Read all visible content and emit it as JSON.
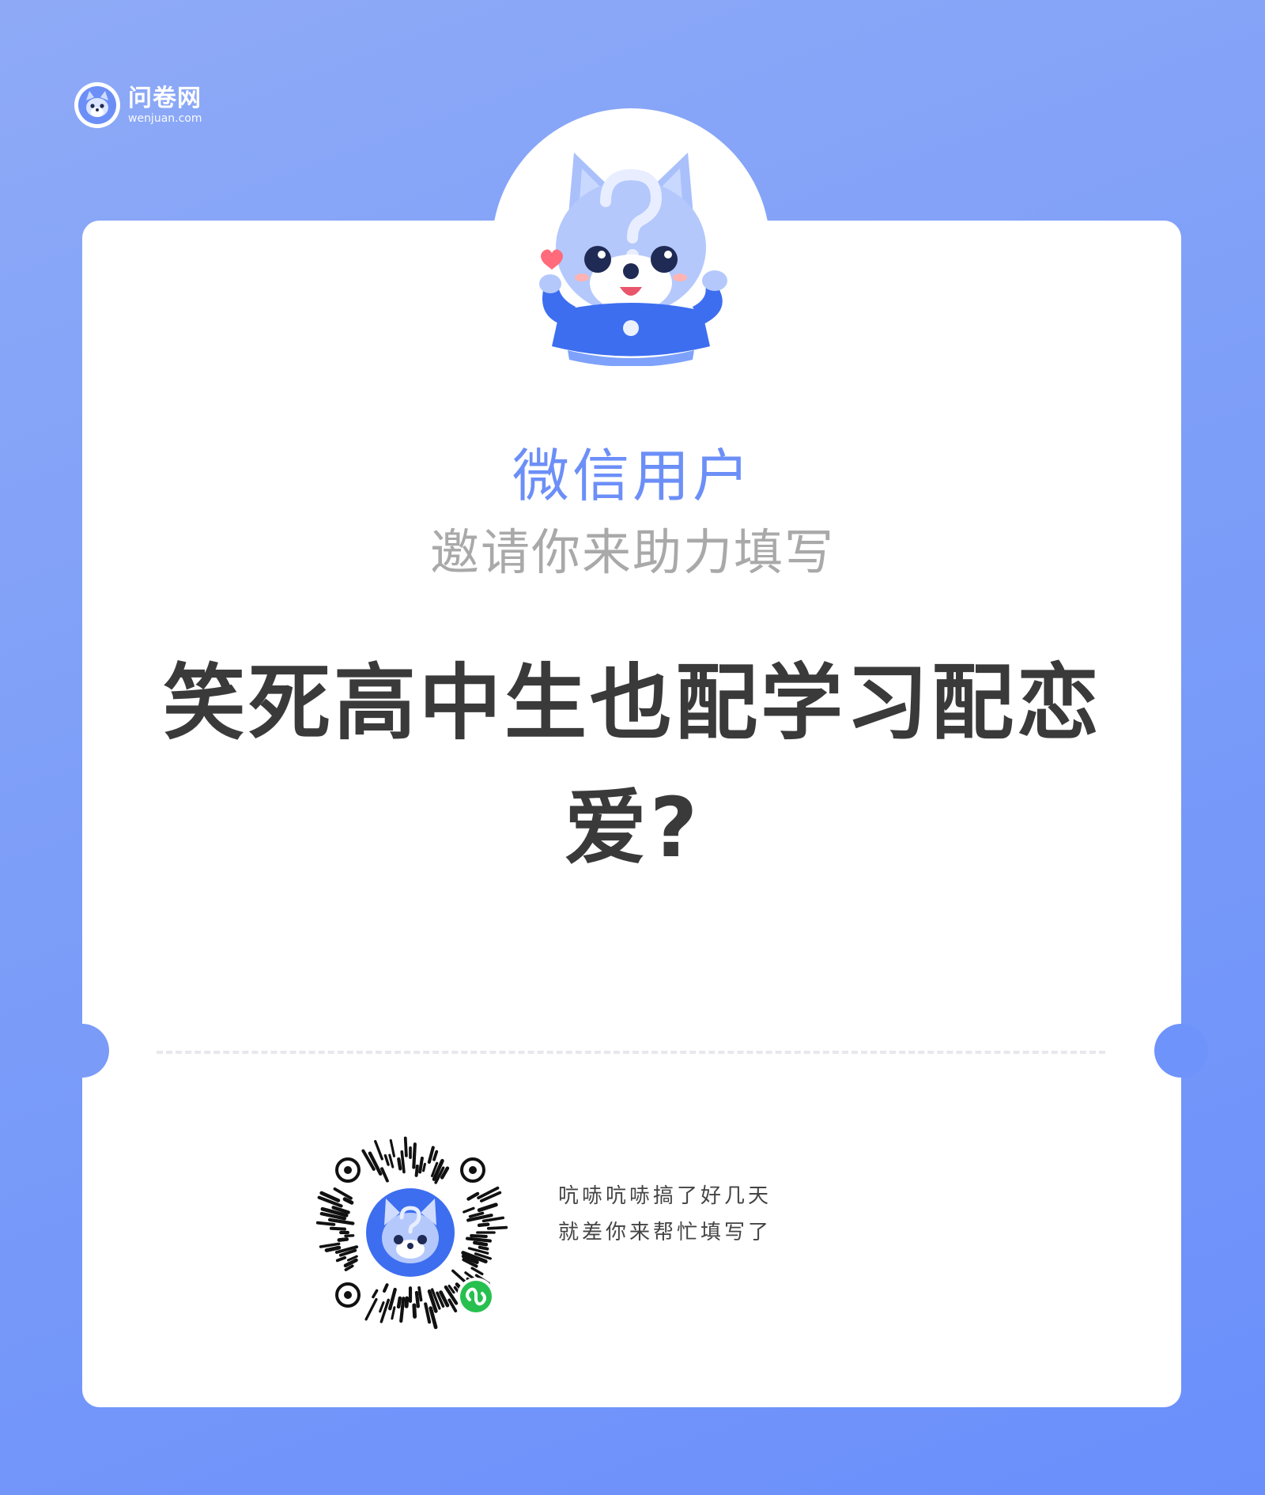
{
  "logo": {
    "name": "问卷网",
    "domain": "wenjuan.com"
  },
  "user": {
    "name": "微信用户"
  },
  "invite": {
    "text": "邀请你来助力填写"
  },
  "survey": {
    "title": "笑死高中生也配学习配恋爱?"
  },
  "qr_caption": {
    "line1": "吭哧吭哧搞了好几天",
    "line2": "就差你来帮忙填写了"
  },
  "colors": {
    "brand_blue": "#6c8ff7",
    "background_gradient": [
      "#8eaaf7",
      "#6a8ffb"
    ],
    "title_text": "#3a3a3a",
    "muted_text": "#a9a9a9",
    "miniprogram_green": "#27c04f"
  },
  "icons": {
    "logo": "fox-mascot-icon",
    "avatar": "fox-mascot-with-question-mark",
    "qr_badge": "wechat-miniprogram-icon"
  }
}
